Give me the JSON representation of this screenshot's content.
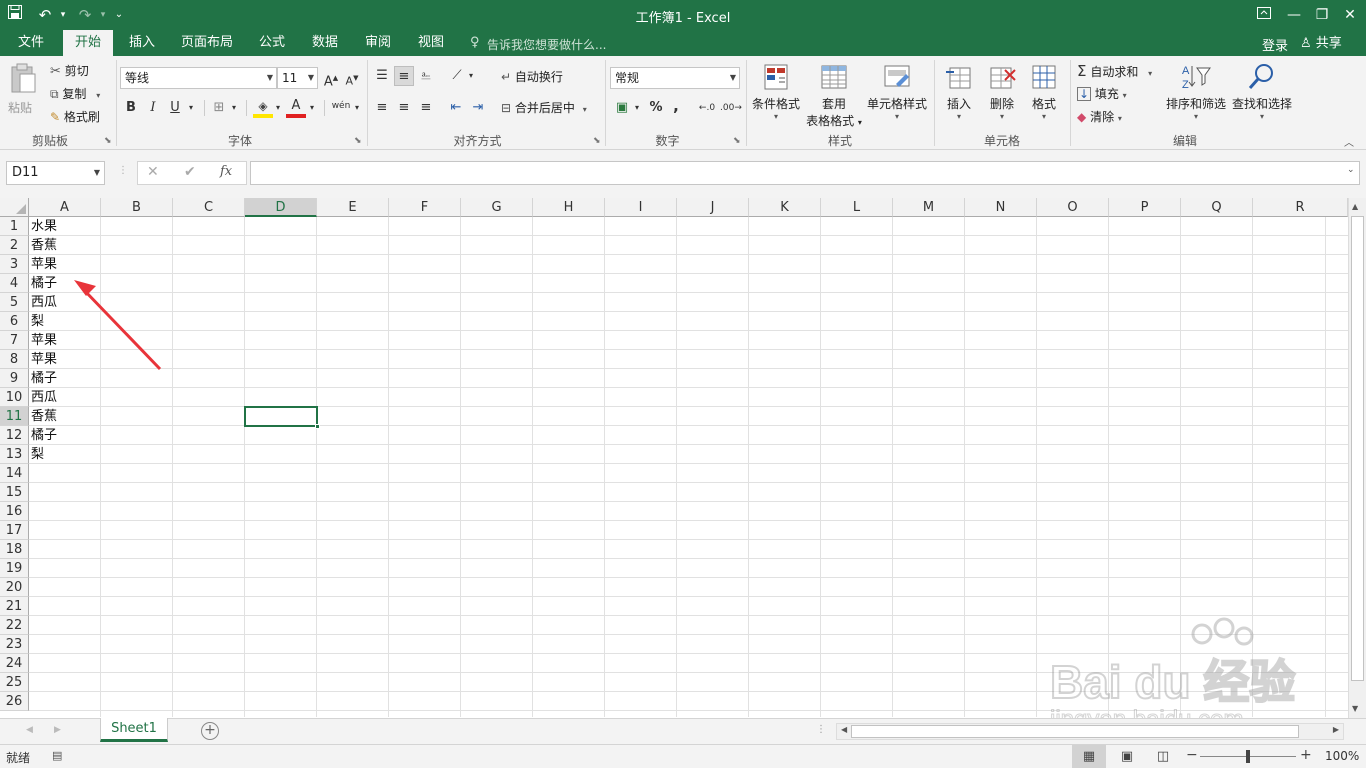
{
  "titlebar": {
    "title": "工作簿1 - Excel",
    "save_icon": "save-icon",
    "undo_icon": "undo-icon",
    "redo_icon": "redo-icon",
    "customize_icon": "customize-qat-icon",
    "window_buttons": [
      "ribbon-display-icon",
      "minimize-icon",
      "restore-icon",
      "close-icon"
    ]
  },
  "tabs": {
    "items": [
      "文件",
      "开始",
      "插入",
      "页面布局",
      "公式",
      "数据",
      "审阅",
      "视图"
    ],
    "active": "开始",
    "tell_me": "告诉我您想要做什么...",
    "login": "登录",
    "share": "共享"
  },
  "ribbon": {
    "clipboard": {
      "label": "剪贴板",
      "paste": "粘贴",
      "cut": "剪切",
      "copy": "复制",
      "format_painter": "格式刷"
    },
    "font": {
      "label": "字体",
      "name": "等线",
      "size": "11",
      "bold": "B",
      "italic": "I",
      "underline": "U",
      "font_color": "A",
      "phonetic": "wén"
    },
    "alignment": {
      "label": "对齐方式",
      "wrap": "自动换行",
      "merge": "合并后居中"
    },
    "number": {
      "label": "数字",
      "format": "常规",
      "percent": "%",
      "comma": ","
    },
    "styles": {
      "label": "样式",
      "conditional": "条件格式",
      "table1": "套用",
      "table2": "表格格式",
      "cell_styles": "单元格样式"
    },
    "cells": {
      "label": "单元格",
      "insert": "插入",
      "delete": "删除",
      "format": "格式"
    },
    "editing": {
      "label": "编辑",
      "autosum": "自动求和",
      "fill": "填充",
      "clear": "清除",
      "sort": "排序和筛选",
      "find": "查找和选择"
    }
  },
  "formula_bar": {
    "name_box": "D11",
    "cancel": "✕",
    "enter": "✔",
    "fx": "fx",
    "value": ""
  },
  "grid": {
    "columns": [
      "A",
      "B",
      "C",
      "D",
      "E",
      "F",
      "G",
      "H",
      "I",
      "J",
      "K",
      "L",
      "M",
      "N",
      "O",
      "P",
      "Q",
      "R"
    ],
    "selected_column": "D",
    "rows": [
      "1",
      "2",
      "3",
      "4",
      "5",
      "6",
      "7",
      "8",
      "9",
      "10",
      "11",
      "12",
      "13",
      "14",
      "15",
      "16",
      "17",
      "18",
      "19",
      "20",
      "21",
      "22",
      "23",
      "24",
      "25",
      "26"
    ],
    "selected_row": "11",
    "column_a": [
      "水果",
      "香蕉",
      "苹果",
      "橘子",
      "西瓜",
      "梨",
      "苹果",
      "苹果",
      "橘子",
      "西瓜",
      "香蕉",
      "橘子",
      "梨"
    ],
    "active_cell": "D11"
  },
  "sheets": {
    "items": [
      "Sheet1"
    ],
    "active": "Sheet1"
  },
  "status": {
    "ready": "就绪",
    "zoom": "100%",
    "minus": "−",
    "plus": "+"
  },
  "watermark": {
    "brand": "Bai du 经验",
    "url": "jingyan.baidu.com"
  },
  "colors": {
    "accent": "#217346",
    "annotation_arrow": "#e8343a"
  }
}
